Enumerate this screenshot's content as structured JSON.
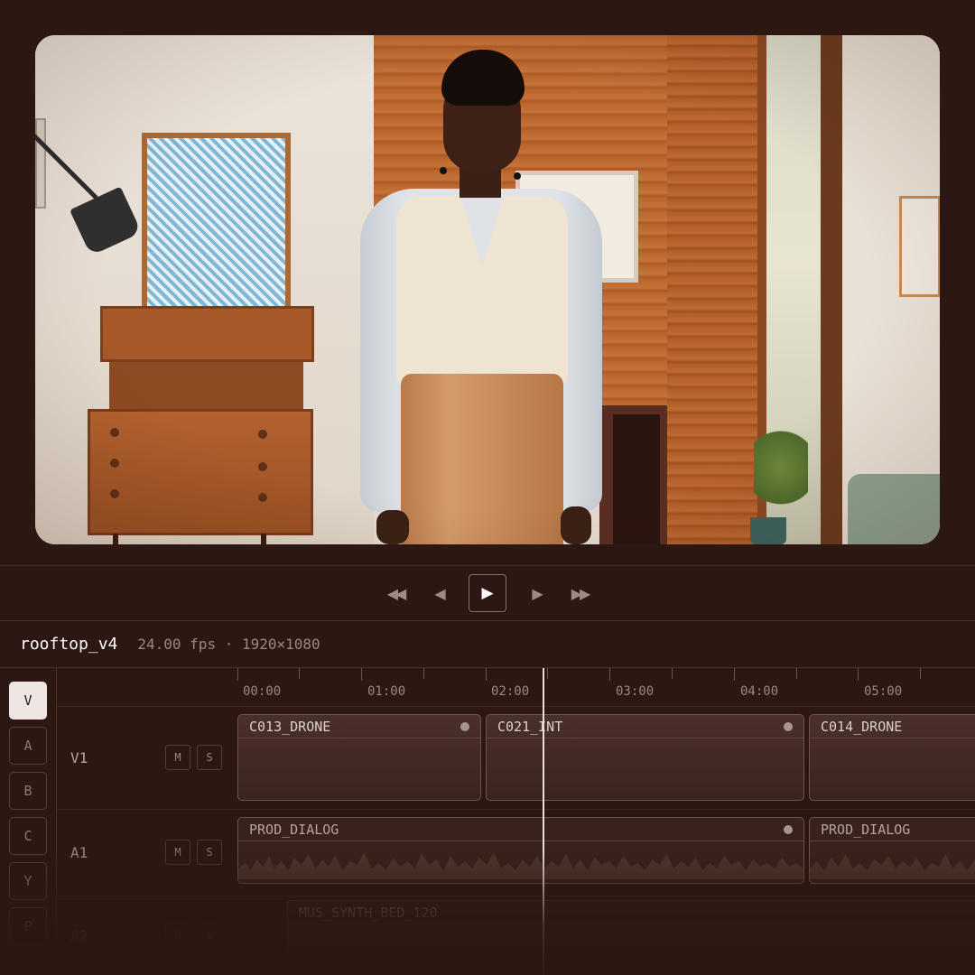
{
  "transport": {
    "rewind_label": "◀◀",
    "step_back_label": "◀",
    "play_label": "▶",
    "step_forward_label": "▶",
    "fast_forward_label": "▶▶"
  },
  "sequence": {
    "name": "rooftop_v4",
    "meta": "24.00 fps · 1920×1080"
  },
  "sources": [
    {
      "label": "V",
      "active": true
    },
    {
      "label": "A",
      "active": false
    },
    {
      "label": "B",
      "active": false
    },
    {
      "label": "C",
      "active": false
    },
    {
      "label": "Y",
      "active": false
    },
    {
      "label": "P",
      "active": false
    }
  ],
  "ruler": {
    "ticks": [
      "00:00",
      "01:00",
      "02:00",
      "03:00",
      "04:00",
      "05:00"
    ]
  },
  "tracks": [
    {
      "name": "V1",
      "mute_label": "M",
      "solo_label": "S",
      "clips": [
        {
          "label": "C013_DRONE",
          "marker": true
        },
        {
          "label": "C021_INT",
          "marker": true
        },
        {
          "label": "C014_DRONE",
          "marker": false
        }
      ]
    },
    {
      "name": "A1",
      "mute_label": "M",
      "solo_label": "S",
      "clips": [
        {
          "label": "PROD_DIALOG",
          "marker": true
        },
        {
          "label": "PROD_DIALOG",
          "marker": false
        }
      ]
    },
    {
      "name": "A2",
      "mute_label": "M",
      "solo_label": "S",
      "clips": [
        {
          "label": "MUS_SYNTH_BED_120",
          "marker": false
        }
      ]
    }
  ],
  "playhead_time": "02:16",
  "colors": {
    "background": "#2c1712",
    "accent": "#ece5e1",
    "clip": "#4a302a"
  }
}
